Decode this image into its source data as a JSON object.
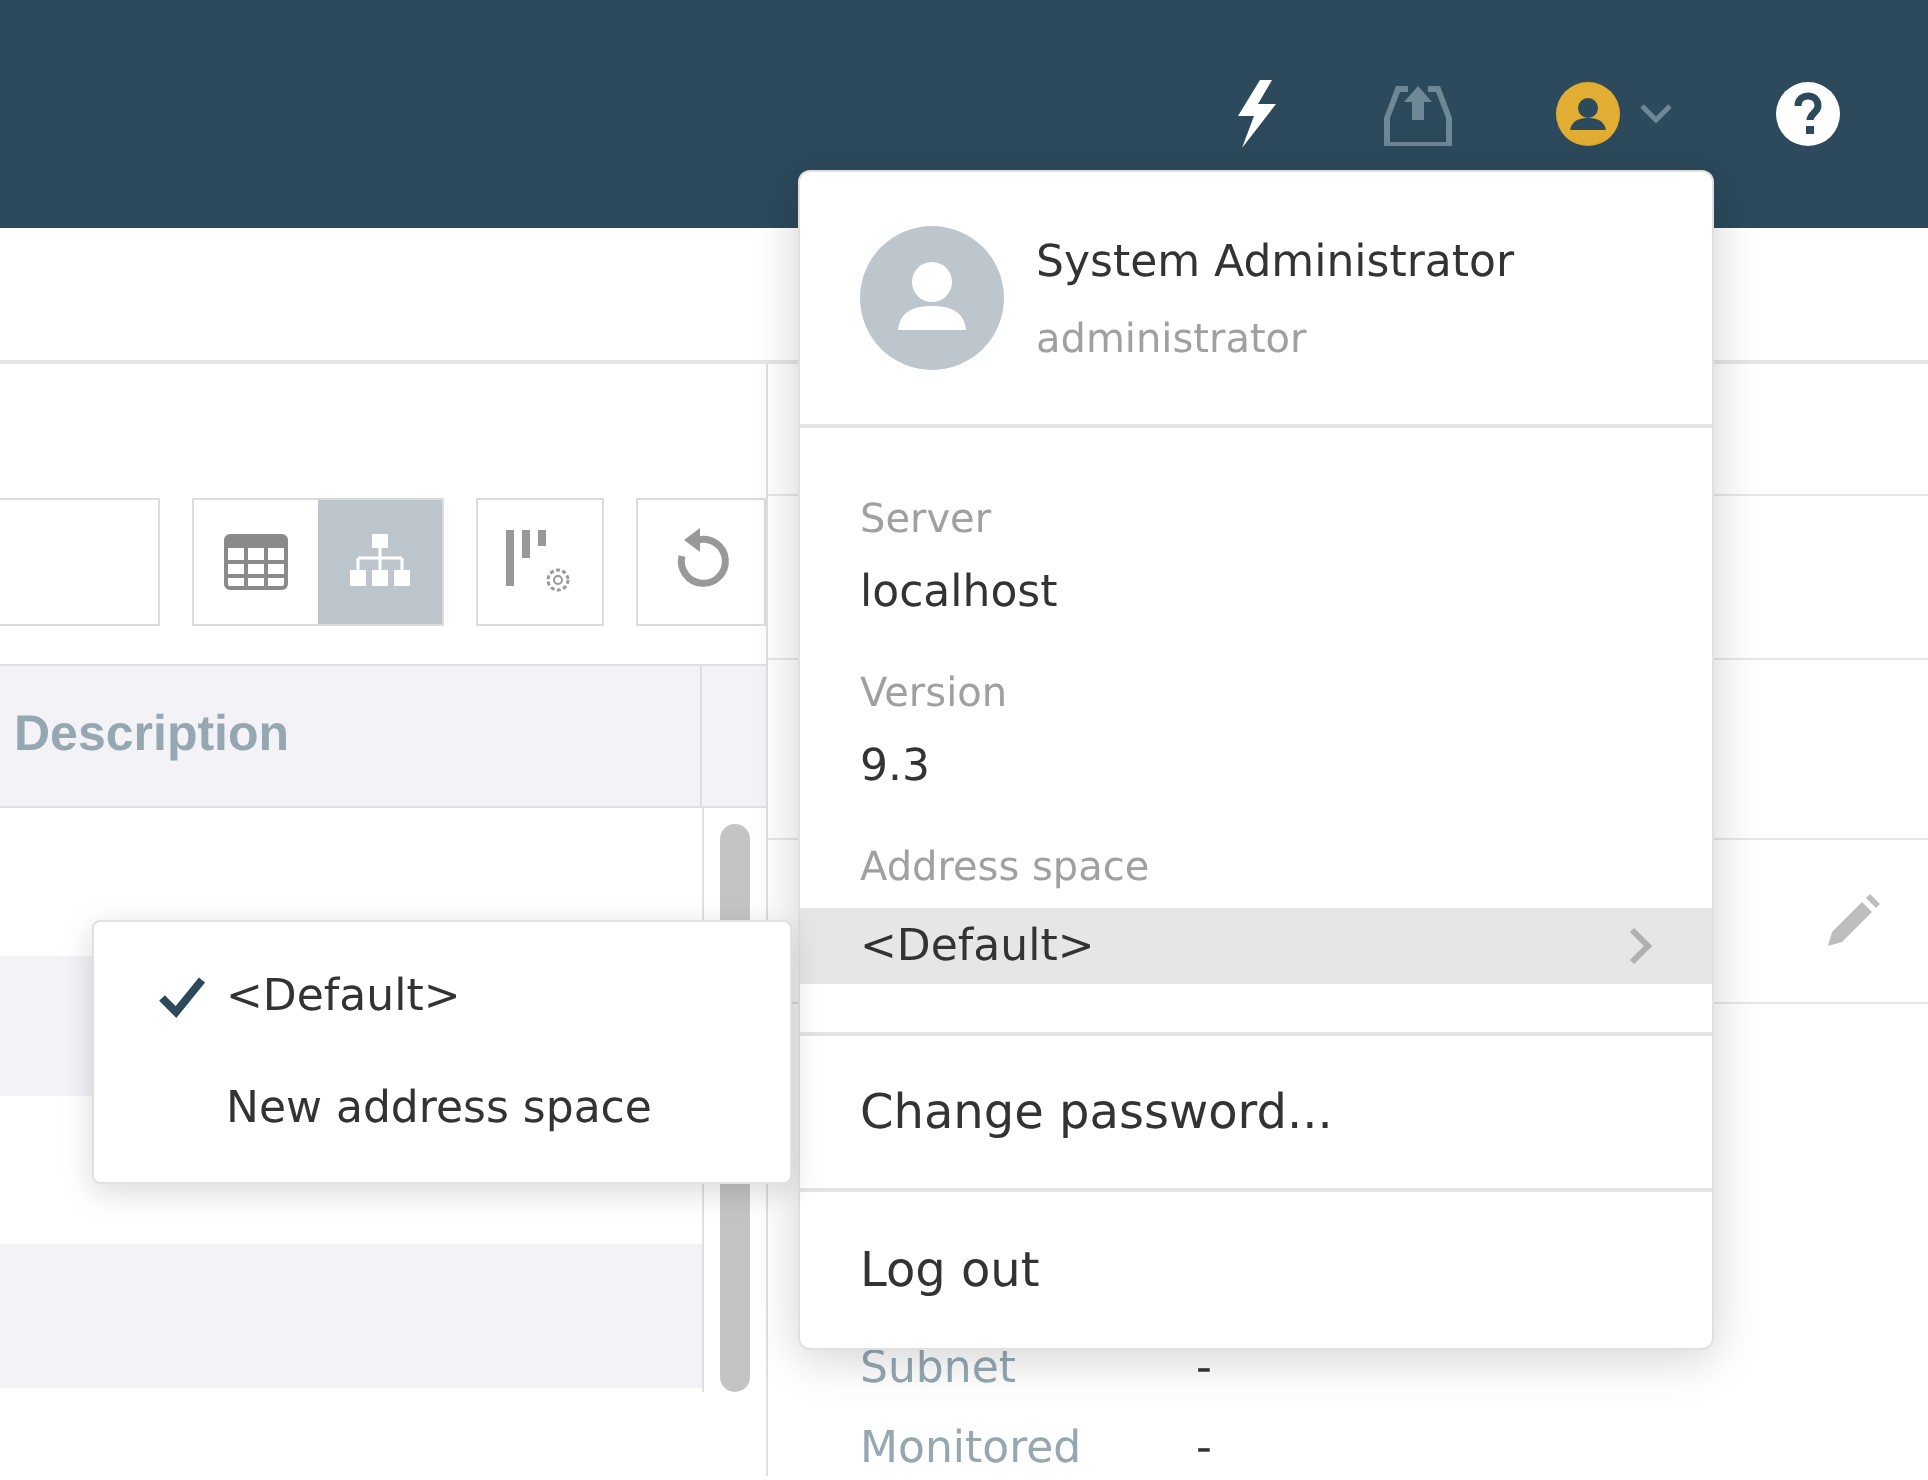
{
  "toolbar": {
    "view_buttons": [
      {
        "kind": "table",
        "selected": false
      },
      {
        "kind": "tree",
        "selected": true
      }
    ]
  },
  "table": {
    "columns": [
      "Description"
    ]
  },
  "details": [
    {
      "label": "Subnet",
      "value": "-"
    },
    {
      "label": "Monitored",
      "value": "-"
    }
  ],
  "user_menu": {
    "name": "System Administrator",
    "login": "administrator",
    "info": [
      {
        "label": "Server",
        "value": "localhost"
      },
      {
        "label": "Version",
        "value": "9.3"
      }
    ],
    "address_space": {
      "label": "Address space",
      "value": "<Default>",
      "highlighted": true
    },
    "actions": [
      "Change password...",
      "Log out"
    ]
  },
  "address_submenu": [
    {
      "label": "<Default>",
      "checked": true
    },
    {
      "label": "New address space",
      "checked": false
    }
  ]
}
